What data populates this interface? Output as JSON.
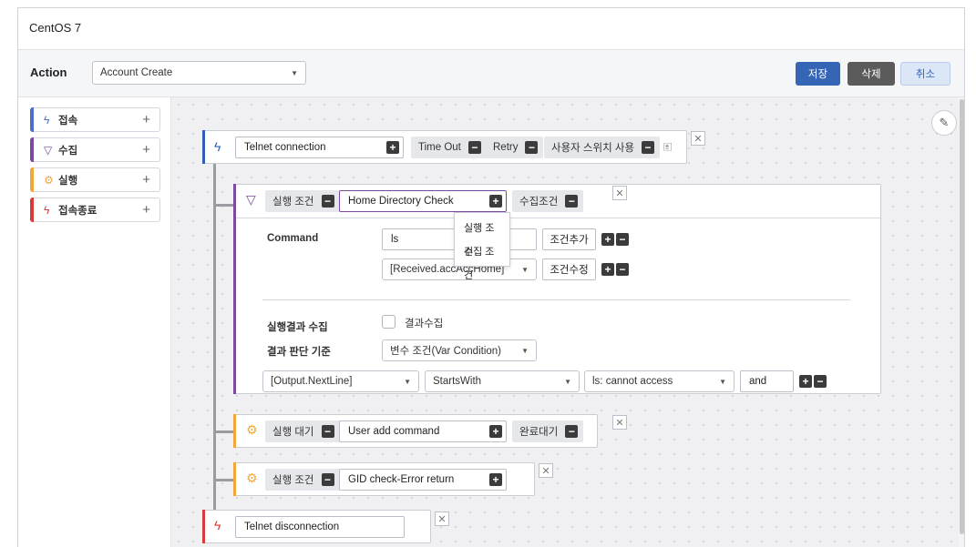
{
  "window": {
    "title": "CentOS 7"
  },
  "action_bar": {
    "label": "Action",
    "selected": "Account Create",
    "save_label": "저장",
    "delete_label": "삭제",
    "cancel_label": "취소"
  },
  "palette": [
    {
      "label": "접속",
      "icon": "bolt-icon",
      "color": "#4a6fc4"
    },
    {
      "label": "수집",
      "icon": "filter-icon",
      "color": "#7a4aa0"
    },
    {
      "label": "실행",
      "icon": "gear-icon",
      "color": "#f0a83c"
    },
    {
      "label": "접속종료",
      "icon": "disconnect-icon",
      "color": "#d83a3a"
    }
  ],
  "flow": {
    "connect": {
      "value": "Telnet connection",
      "timeout": "Time Out",
      "retry": "Retry",
      "user_switch": "사용자 스위치 사용"
    },
    "collect": {
      "cond_label": "실행 조건",
      "value": "Home Directory Check",
      "collect_cond": "수집조건",
      "menu": [
        "실행 조건",
        "수집 조건"
      ],
      "command_label": "Command",
      "command_value": "ls",
      "add_cond": "조건추가",
      "received": "[Received.accAccHome]",
      "edit_cond": "조건수정",
      "result_collect_label": "실행결과 수집",
      "result_collect_check": "결과수집",
      "judge_label": "결과 판단 기준",
      "judge_value": "변수 조건(Var Condition)",
      "rule": {
        "var": "[Output.NextLine]",
        "op": "StartsWith",
        "value": "ls: cannot access",
        "logic": "and"
      }
    },
    "exec1": {
      "cond_label": "실행 대기",
      "value": "User add command",
      "done_wait": "완료대기"
    },
    "exec2": {
      "cond_label": "실행 조건",
      "value": "GID check-Error return"
    },
    "disconnect": {
      "value": "Telnet disconnection"
    }
  },
  "colors": {
    "connect": "#2f5db8",
    "collect": "#7a4aa0",
    "exec": "#f0a83c",
    "disconnect": "#d83a3a",
    "primary": "#3566b5"
  }
}
